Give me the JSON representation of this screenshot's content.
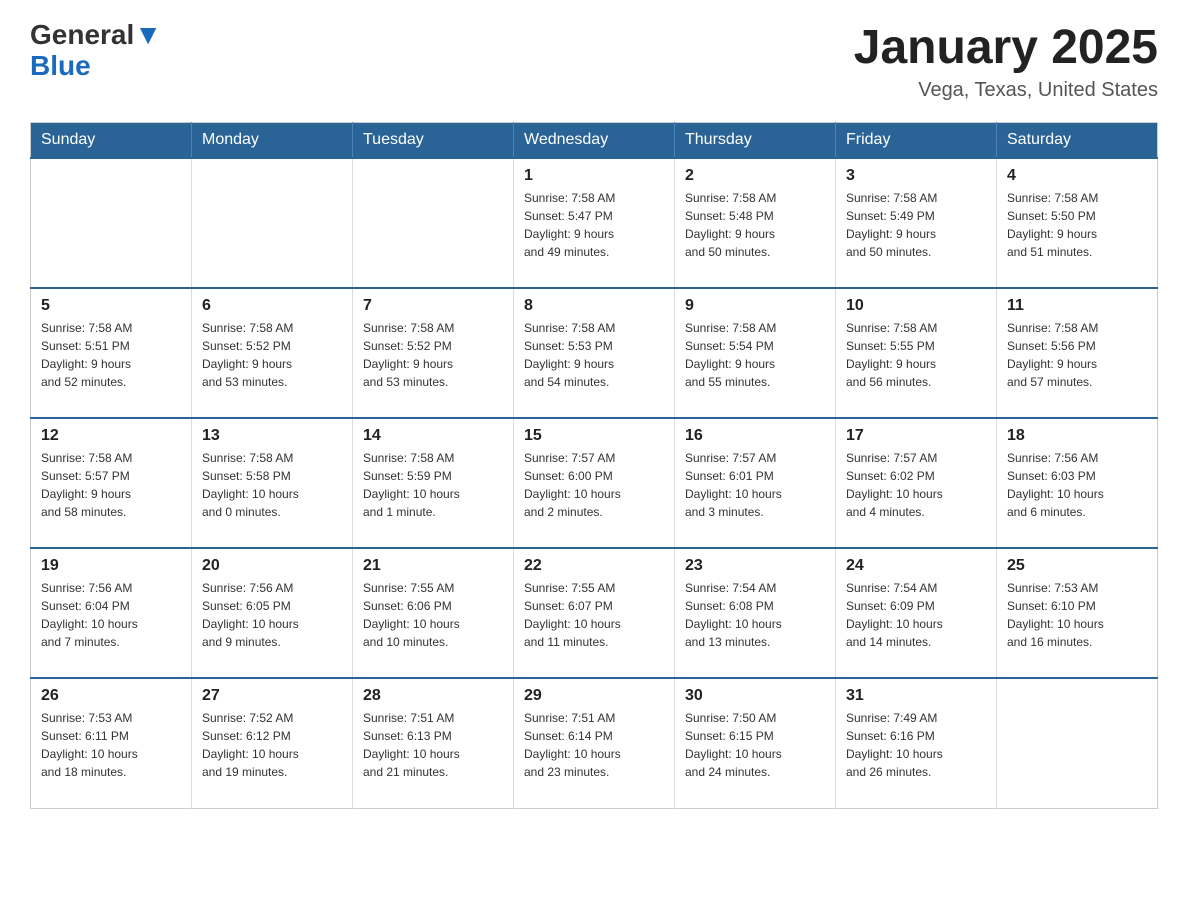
{
  "header": {
    "logo_line1": "General",
    "logo_line2": "Blue",
    "main_title": "January 2025",
    "subtitle": "Vega, Texas, United States"
  },
  "days_of_week": [
    "Sunday",
    "Monday",
    "Tuesday",
    "Wednesday",
    "Thursday",
    "Friday",
    "Saturday"
  ],
  "weeks": [
    [
      {
        "day": "",
        "info": ""
      },
      {
        "day": "",
        "info": ""
      },
      {
        "day": "",
        "info": ""
      },
      {
        "day": "1",
        "info": "Sunrise: 7:58 AM\nSunset: 5:47 PM\nDaylight: 9 hours\nand 49 minutes."
      },
      {
        "day": "2",
        "info": "Sunrise: 7:58 AM\nSunset: 5:48 PM\nDaylight: 9 hours\nand 50 minutes."
      },
      {
        "day": "3",
        "info": "Sunrise: 7:58 AM\nSunset: 5:49 PM\nDaylight: 9 hours\nand 50 minutes."
      },
      {
        "day": "4",
        "info": "Sunrise: 7:58 AM\nSunset: 5:50 PM\nDaylight: 9 hours\nand 51 minutes."
      }
    ],
    [
      {
        "day": "5",
        "info": "Sunrise: 7:58 AM\nSunset: 5:51 PM\nDaylight: 9 hours\nand 52 minutes."
      },
      {
        "day": "6",
        "info": "Sunrise: 7:58 AM\nSunset: 5:52 PM\nDaylight: 9 hours\nand 53 minutes."
      },
      {
        "day": "7",
        "info": "Sunrise: 7:58 AM\nSunset: 5:52 PM\nDaylight: 9 hours\nand 53 minutes."
      },
      {
        "day": "8",
        "info": "Sunrise: 7:58 AM\nSunset: 5:53 PM\nDaylight: 9 hours\nand 54 minutes."
      },
      {
        "day": "9",
        "info": "Sunrise: 7:58 AM\nSunset: 5:54 PM\nDaylight: 9 hours\nand 55 minutes."
      },
      {
        "day": "10",
        "info": "Sunrise: 7:58 AM\nSunset: 5:55 PM\nDaylight: 9 hours\nand 56 minutes."
      },
      {
        "day": "11",
        "info": "Sunrise: 7:58 AM\nSunset: 5:56 PM\nDaylight: 9 hours\nand 57 minutes."
      }
    ],
    [
      {
        "day": "12",
        "info": "Sunrise: 7:58 AM\nSunset: 5:57 PM\nDaylight: 9 hours\nand 58 minutes."
      },
      {
        "day": "13",
        "info": "Sunrise: 7:58 AM\nSunset: 5:58 PM\nDaylight: 10 hours\nand 0 minutes."
      },
      {
        "day": "14",
        "info": "Sunrise: 7:58 AM\nSunset: 5:59 PM\nDaylight: 10 hours\nand 1 minute."
      },
      {
        "day": "15",
        "info": "Sunrise: 7:57 AM\nSunset: 6:00 PM\nDaylight: 10 hours\nand 2 minutes."
      },
      {
        "day": "16",
        "info": "Sunrise: 7:57 AM\nSunset: 6:01 PM\nDaylight: 10 hours\nand 3 minutes."
      },
      {
        "day": "17",
        "info": "Sunrise: 7:57 AM\nSunset: 6:02 PM\nDaylight: 10 hours\nand 4 minutes."
      },
      {
        "day": "18",
        "info": "Sunrise: 7:56 AM\nSunset: 6:03 PM\nDaylight: 10 hours\nand 6 minutes."
      }
    ],
    [
      {
        "day": "19",
        "info": "Sunrise: 7:56 AM\nSunset: 6:04 PM\nDaylight: 10 hours\nand 7 minutes."
      },
      {
        "day": "20",
        "info": "Sunrise: 7:56 AM\nSunset: 6:05 PM\nDaylight: 10 hours\nand 9 minutes."
      },
      {
        "day": "21",
        "info": "Sunrise: 7:55 AM\nSunset: 6:06 PM\nDaylight: 10 hours\nand 10 minutes."
      },
      {
        "day": "22",
        "info": "Sunrise: 7:55 AM\nSunset: 6:07 PM\nDaylight: 10 hours\nand 11 minutes."
      },
      {
        "day": "23",
        "info": "Sunrise: 7:54 AM\nSunset: 6:08 PM\nDaylight: 10 hours\nand 13 minutes."
      },
      {
        "day": "24",
        "info": "Sunrise: 7:54 AM\nSunset: 6:09 PM\nDaylight: 10 hours\nand 14 minutes."
      },
      {
        "day": "25",
        "info": "Sunrise: 7:53 AM\nSunset: 6:10 PM\nDaylight: 10 hours\nand 16 minutes."
      }
    ],
    [
      {
        "day": "26",
        "info": "Sunrise: 7:53 AM\nSunset: 6:11 PM\nDaylight: 10 hours\nand 18 minutes."
      },
      {
        "day": "27",
        "info": "Sunrise: 7:52 AM\nSunset: 6:12 PM\nDaylight: 10 hours\nand 19 minutes."
      },
      {
        "day": "28",
        "info": "Sunrise: 7:51 AM\nSunset: 6:13 PM\nDaylight: 10 hours\nand 21 minutes."
      },
      {
        "day": "29",
        "info": "Sunrise: 7:51 AM\nSunset: 6:14 PM\nDaylight: 10 hours\nand 23 minutes."
      },
      {
        "day": "30",
        "info": "Sunrise: 7:50 AM\nSunset: 6:15 PM\nDaylight: 10 hours\nand 24 minutes."
      },
      {
        "day": "31",
        "info": "Sunrise: 7:49 AM\nSunset: 6:16 PM\nDaylight: 10 hours\nand 26 minutes."
      },
      {
        "day": "",
        "info": ""
      }
    ]
  ]
}
